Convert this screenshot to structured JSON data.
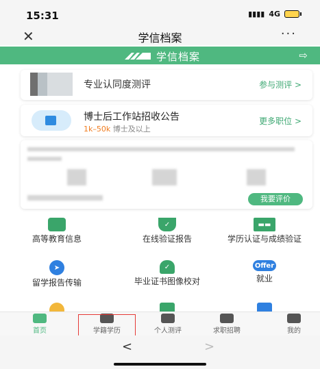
{
  "status": {
    "time": "15:31",
    "network": "4G"
  },
  "nav": {
    "close_icon": "✕",
    "title": "学信档案",
    "more_icon": "···"
  },
  "brand": {
    "name": "学信档案",
    "exit_icon": "⇨",
    "color": "#4fb880"
  },
  "cards": {
    "eval": {
      "label": "专业认同度测评",
      "link": "参与测评 >"
    },
    "job": {
      "label": "博士后工作站招收公告",
      "salary": "1k–50k",
      "req": "博士及以上",
      "link": "更多职位 >"
    },
    "rating": {
      "button": "我要评价"
    }
  },
  "grid": [
    {
      "label": "高等教育信息",
      "icon": "graduate-icon",
      "color": "#3aa56a"
    },
    {
      "label": "在线验证报告",
      "icon": "shield-check-icon",
      "color": "#3aa56a"
    },
    {
      "label": "学历认证与成绩验证",
      "icon": "certificate-icon",
      "color": "#3aa56a"
    },
    {
      "label": "留学报告传输",
      "icon": "send-icon",
      "color": "#2f80e0"
    },
    {
      "label": "毕业证书图像校对",
      "icon": "user-check-icon",
      "color": "#3aa56a"
    },
    {
      "label": "就业",
      "icon": "offer-icon",
      "text": "Offer",
      "color": "#2f80e0"
    }
  ],
  "tabs": [
    {
      "label": "首页",
      "active": true
    },
    {
      "label": "学籍学历",
      "active": false
    },
    {
      "label": "个人测评",
      "active": false
    },
    {
      "label": "求职招聘",
      "active": false
    },
    {
      "label": "我的",
      "active": false
    }
  ],
  "browser": {
    "back": "<",
    "forward": ">"
  }
}
